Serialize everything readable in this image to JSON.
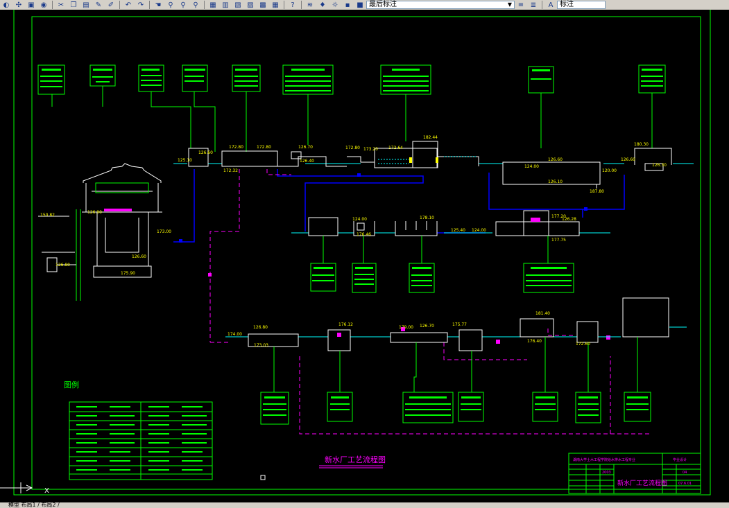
{
  "toolbar": {
    "icons": [
      "zoom-realtime-icon",
      "pan-icon",
      "open-icon",
      "save-icon",
      "cut-icon",
      "copy-icon",
      "paste-icon",
      "brush-icon",
      "match-icon",
      "undo-icon",
      "redo-icon",
      "hand-icon",
      "zoom-icon",
      "zoom-window-icon",
      "zoom-prev-icon",
      "properties-icon",
      "design-center-icon",
      "tool-palette-icon",
      "sheet-icon",
      "markup-icon",
      "calc-icon",
      "help-icon"
    ],
    "layer_icons": [
      "layers-icon",
      "bulb-icon",
      "sun-icon",
      "lock-icon",
      "color-icon"
    ],
    "layer_select": "最后标注",
    "right_icons": [
      "layer-prev-icon",
      "layer-states-icon"
    ],
    "dim_label": "标注"
  },
  "drawing": {
    "main_title": "新水厂工艺流程图",
    "legend_title": "图例",
    "title_block": {
      "school": "湖南大学土木工程学院给水排水工程专业",
      "design": "毕业设计",
      "year": "2003",
      "title": "新水厂工艺流程图",
      "sheet_no": "04",
      "date": "07.6.01"
    },
    "top_elevations": [
      "126.60",
      "125.10",
      "172.80",
      "172.80",
      "172.32",
      "126.70",
      "126.40",
      "172.80",
      "173.20",
      "172.64",
      "182.44",
      "180.30",
      "126.60",
      "126.30",
      "126.60",
      "120.00",
      "187.80",
      "124.00",
      "126.10"
    ],
    "mid_elevations": [
      "124.00",
      "176.46",
      "178.10",
      "125.40",
      "124.00",
      "177.20",
      "126.28",
      "177.75"
    ],
    "bottom_elevations": [
      "126.80",
      "174.00",
      "173.03",
      "176.12",
      "179.00",
      "126.70",
      "175.77",
      "181.40",
      "176.40",
      "172.60"
    ],
    "left_elevations": [
      "150.82",
      "126.90",
      "126.80",
      "126.60",
      "175.90",
      "173.00"
    ],
    "coords_label": "X"
  },
  "command": {
    "text": "模型  布局1 / 布局2 /"
  },
  "colors": {
    "frame": "#00ff00",
    "pipe": "#0000ff",
    "magenta": "#ff00ff",
    "text": "#ffff00"
  }
}
